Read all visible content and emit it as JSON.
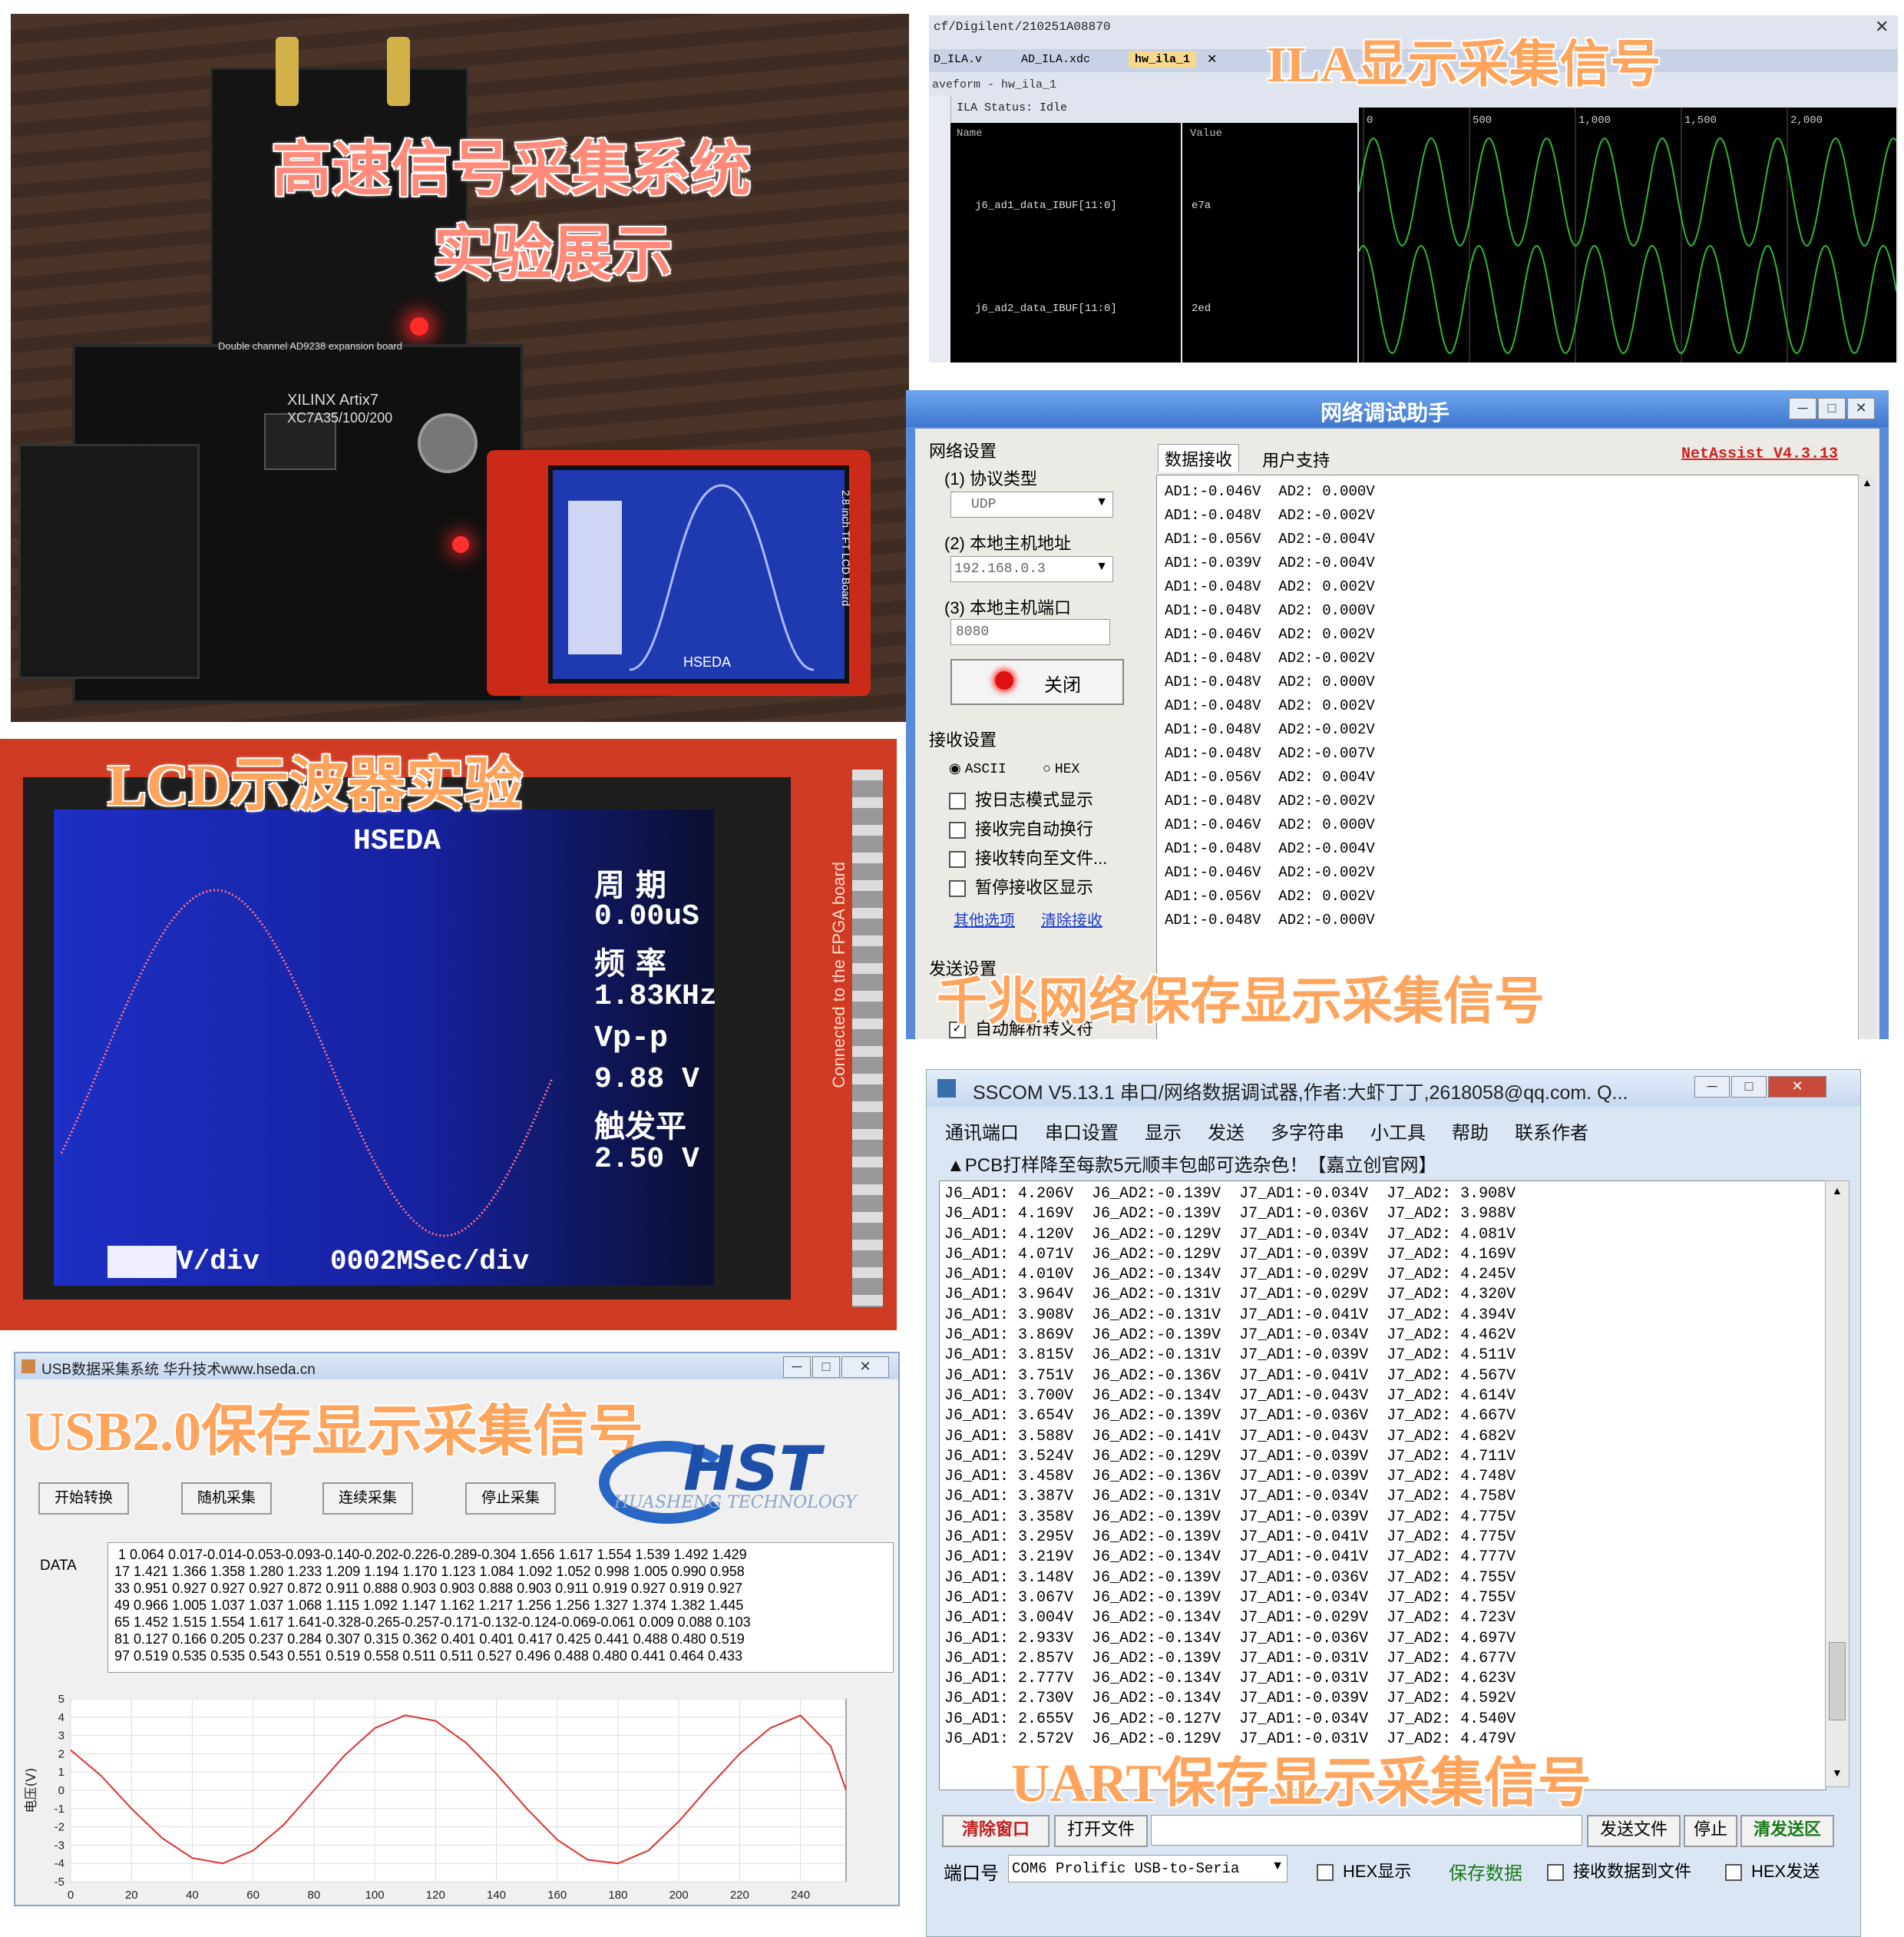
{
  "hardware_photo": {
    "title_line1": "高速信号采集系统",
    "title_line2": "实验展示",
    "board_label": "XILINX Artix7",
    "board_model": "XC7A35/100/200",
    "expansion_label": "Double channel AD9238 expansion board",
    "lcd_label": "2.8 inch TFT LCD Board",
    "lcd_bottom": "HSEDA"
  },
  "ila": {
    "caption": "ILA显示采集信号",
    "path": "cf/Digilent/210251A08870",
    "tabs": [
      "D_ILA.v",
      "AD_ILA.xdc",
      "hw_ila_1"
    ],
    "waveform_label": "aveform - hw_ila_1",
    "status": "ILA Status: Idle",
    "col_name": "Name",
    "col_value": "Value",
    "signals": [
      {
        "name": "j6_ad1_data_IBUF[11:0]",
        "value": "e7a"
      },
      {
        "name": "j6_ad2_data_IBUF[11:0]",
        "value": "2ed"
      }
    ],
    "ticks": [
      "0",
      "500",
      "1,000",
      "1,500",
      "2,000"
    ],
    "colors": {
      "wave": "#2fb82f",
      "bg": "#000000"
    }
  },
  "netassist": {
    "title": "网络调试助手",
    "brand": "NetAssist V4.3.13",
    "section_net": "网络设置",
    "protocol_label": "(1) 协议类型",
    "protocol_value": "UDP",
    "host_label": "(2) 本地主机地址",
    "host_value": "192.168.0.3",
    "port_label": "(3) 本地主机端口",
    "port_value": "8080",
    "close_button": "关闭",
    "section_recv": "接收设置",
    "radio_ascii": "ASCII",
    "radio_hex": "HEX",
    "opt1": "按日志模式显示",
    "opt2": "接收完自动换行",
    "opt3": "接收转向至文件...",
    "opt4": "暂停接收区显示",
    "link_more": "其他选项",
    "link_clear": "清除接收",
    "section_send": "发送设置",
    "opt_escape": "自动解析转义符",
    "tab_recv": "数据接收",
    "tab_support": "用户支持",
    "rows": [
      "AD1:-0.046V  AD2: 0.000V",
      "AD1:-0.048V  AD2:-0.002V",
      "AD1:-0.056V  AD2:-0.004V",
      "AD1:-0.039V  AD2:-0.004V",
      "AD1:-0.048V  AD2: 0.002V",
      "AD1:-0.048V  AD2: 0.000V",
      "AD1:-0.046V  AD2: 0.002V",
      "AD1:-0.048V  AD2:-0.002V",
      "AD1:-0.048V  AD2: 0.000V",
      "AD1:-0.048V  AD2: 0.002V",
      "AD1:-0.048V  AD2:-0.002V",
      "AD1:-0.048V  AD2:-0.007V",
      "AD1:-0.056V  AD2: 0.004V",
      "AD1:-0.048V  AD2:-0.002V",
      "AD1:-0.046V  AD2: 0.000V",
      "AD1:-0.048V  AD2:-0.004V",
      "AD1:-0.046V  AD2:-0.002V",
      "AD1:-0.056V  AD2: 0.002V",
      "AD1:-0.048V  AD2:-0.000V"
    ],
    "caption": "千兆网络保存显示采集信号"
  },
  "lcd_scope": {
    "caption": "LCD示波器实验",
    "brand": "HSEDA",
    "period_label": "周  期",
    "period_value": "0.00uS",
    "freq_label": "频  率",
    "freq_value": "1.83KHz",
    "vpp_label": "Vp-p",
    "vpp_value": "9.88 V",
    "trigger_label": "触发平",
    "trigger_value": "2.50 V",
    "vdiv": "V/div",
    "tdiv": "0002MSec/div",
    "board_text": "Connected to the FPGA board"
  },
  "sscom": {
    "title": "SSCOM V5.13.1 串口/网络数据调试器,作者:大虾丁丁,2618058@qq.com. Q...",
    "menu": [
      "通讯端口",
      "串口设置",
      "显示",
      "发送",
      "多字符串",
      "小工具",
      "帮助",
      "联系作者"
    ],
    "ad_banner": "▲PCB打样降至每款5元顺丰包邮可选杂色！【嘉立创官网】",
    "rows": [
      "J6_AD1: 4.206V  J6_AD2:-0.139V  J7_AD1:-0.034V  J7_AD2: 3.908V",
      "J6_AD1: 4.169V  J6_AD2:-0.139V  J7_AD1:-0.036V  J7_AD2: 3.988V",
      "J6_AD1: 4.120V  J6_AD2:-0.129V  J7_AD1:-0.034V  J7_AD2: 4.081V",
      "J6_AD1: 4.071V  J6_AD2:-0.129V  J7_AD1:-0.039V  J7_AD2: 4.169V",
      "J6_AD1: 4.010V  J6_AD2:-0.134V  J7_AD1:-0.029V  J7_AD2: 4.245V",
      "J6_AD1: 3.964V  J6_AD2:-0.131V  J7_AD1:-0.029V  J7_AD2: 4.320V",
      "J6_AD1: 3.908V  J6_AD2:-0.131V  J7_AD1:-0.041V  J7_AD2: 4.394V",
      "J6_AD1: 3.869V  J6_AD2:-0.139V  J7_AD1:-0.034V  J7_AD2: 4.462V",
      "J6_AD1: 3.815V  J6_AD2:-0.131V  J7_AD1:-0.039V  J7_AD2: 4.511V",
      "J6_AD1: 3.751V  J6_AD2:-0.136V  J7_AD1:-0.041V  J7_AD2: 4.567V",
      "J6_AD1: 3.700V  J6_AD2:-0.134V  J7_AD1:-0.043V  J7_AD2: 4.614V",
      "J6_AD1: 3.654V  J6_AD2:-0.139V  J7_AD1:-0.036V  J7_AD2: 4.667V",
      "J6_AD1: 3.588V  J6_AD2:-0.141V  J7_AD1:-0.043V  J7_AD2: 4.682V",
      "J6_AD1: 3.524V  J6_AD2:-0.129V  J7_AD1:-0.039V  J7_AD2: 4.711V",
      "J6_AD1: 3.458V  J6_AD2:-0.136V  J7_AD1:-0.039V  J7_AD2: 4.748V",
      "J6_AD1: 3.387V  J6_AD2:-0.131V  J7_AD1:-0.034V  J7_AD2: 4.758V",
      "J6_AD1: 3.358V  J6_AD2:-0.139V  J7_AD1:-0.039V  J7_AD2: 4.775V",
      "J6_AD1: 3.295V  J6_AD2:-0.139V  J7_AD1:-0.041V  J7_AD2: 4.775V",
      "J6_AD1: 3.219V  J6_AD2:-0.134V  J7_AD1:-0.041V  J7_AD2: 4.777V",
      "J6_AD1: 3.148V  J6_AD2:-0.139V  J7_AD1:-0.036V  J7_AD2: 4.755V",
      "J6_AD1: 3.067V  J6_AD2:-0.139V  J7_AD1:-0.034V  J7_AD2: 4.755V",
      "J6_AD1: 3.004V  J6_AD2:-0.134V  J7_AD1:-0.029V  J7_AD2: 4.723V",
      "J6_AD1: 2.933V  J6_AD2:-0.134V  J7_AD1:-0.036V  J7_AD2: 4.697V",
      "J6_AD1: 2.857V  J6_AD2:-0.139V  J7_AD1:-0.031V  J7_AD2: 4.677V",
      "J6_AD1: 2.777V  J6_AD2:-0.134V  J7_AD1:-0.031V  J7_AD2: 4.623V",
      "J6_AD1: 2.730V  J6_AD2:-0.134V  J7_AD1:-0.039V  J7_AD2: 4.592V",
      "J6_AD1: 2.655V  J6_AD2:-0.127V  J7_AD1:-0.034V  J7_AD2: 4.540V",
      "J6_AD1: 2.572V  J6_AD2:-0.129V  J7_AD1:-0.031V  J7_AD2: 4.479V"
    ],
    "caption": "UART保存显示采集信号",
    "btn_clear": "清除窗口",
    "btn_open": "打开文件",
    "btn_sendfile": "发送文件",
    "btn_stop": "停止",
    "btn_clearsend": "清发送区",
    "port_label": "端口号",
    "port_value": "COM6 Prolific USB-to-Seria",
    "hex_show": "HEX显示",
    "save_data": "保存数据",
    "recv_to_file": "接收数据到文件",
    "hex_send": "HEX发送"
  },
  "usb": {
    "title": "USB数据采集系统 华升技术www.hseda.cn",
    "caption": "USB2.0保存显示采集信号",
    "logo": "HST",
    "logo_sub": "HUASHENG TECHNOLOGY",
    "buttons": [
      "开始转换",
      "随机采集",
      "连续采集",
      "停止采集"
    ],
    "data_label": "DATA",
    "data_rows": [
      " 1 0.064 0.017-0.014-0.053-0.093-0.140-0.202-0.226-0.289-0.304 1.656 1.617 1.554 1.539 1.492 1.429",
      "17 1.421 1.366 1.358 1.280 1.233 1.209 1.194 1.170 1.123 1.084 1.092 1.052 0.998 1.005 0.990 0.958",
      "33 0.951 0.927 0.927 0.927 0.872 0.911 0.888 0.903 0.903 0.888 0.903 0.911 0.919 0.927 0.919 0.927",
      "49 0.966 1.005 1.037 1.037 1.068 1.115 1.092 1.147 1.162 1.217 1.256 1.256 1.327 1.374 1.382 1.445",
      "65 1.452 1.515 1.554 1.617 1.641-0.328-0.265-0.257-0.171-0.132-0.124-0.069-0.061 0.009 0.088 0.103",
      "81 0.127 0.166 0.205 0.237 0.284 0.307 0.315 0.362 0.401 0.401 0.417 0.425 0.441 0.488 0.480 0.519",
      "97 0.519 0.535 0.535 0.543 0.551 0.519 0.558 0.511 0.511 0.527 0.496 0.488 0.480 0.441 0.464 0.433"
    ],
    "chart_data": {
      "type": "line",
      "ylabel": "电压(V)",
      "xlim": [
        0,
        255
      ],
      "ylim": [
        -5,
        5
      ],
      "xticks": [
        0,
        20,
        40,
        60,
        80,
        100,
        120,
        140,
        160,
        180,
        200,
        220,
        240
      ],
      "yticks": [
        5,
        4,
        3,
        2,
        1,
        0,
        -1,
        -2,
        -3,
        -4,
        -5
      ],
      "grid": true,
      "series": [
        {
          "color": "#e03030",
          "x": [
            0,
            10,
            20,
            30,
            40,
            50,
            60,
            70,
            80,
            90,
            100,
            110,
            120,
            130,
            140,
            150,
            160,
            170,
            180,
            190,
            200,
            210,
            220,
            230,
            240,
            250,
            255
          ],
          "y": [
            2.2,
            0.8,
            -1.0,
            -2.6,
            -3.7,
            -4.0,
            -3.3,
            -1.9,
            0.0,
            1.9,
            3.4,
            4.1,
            3.8,
            2.6,
            0.9,
            -1.0,
            -2.7,
            -3.8,
            -4.0,
            -3.3,
            -1.7,
            0.2,
            2.0,
            3.4,
            4.1,
            2.4,
            0.0
          ]
        }
      ]
    }
  }
}
